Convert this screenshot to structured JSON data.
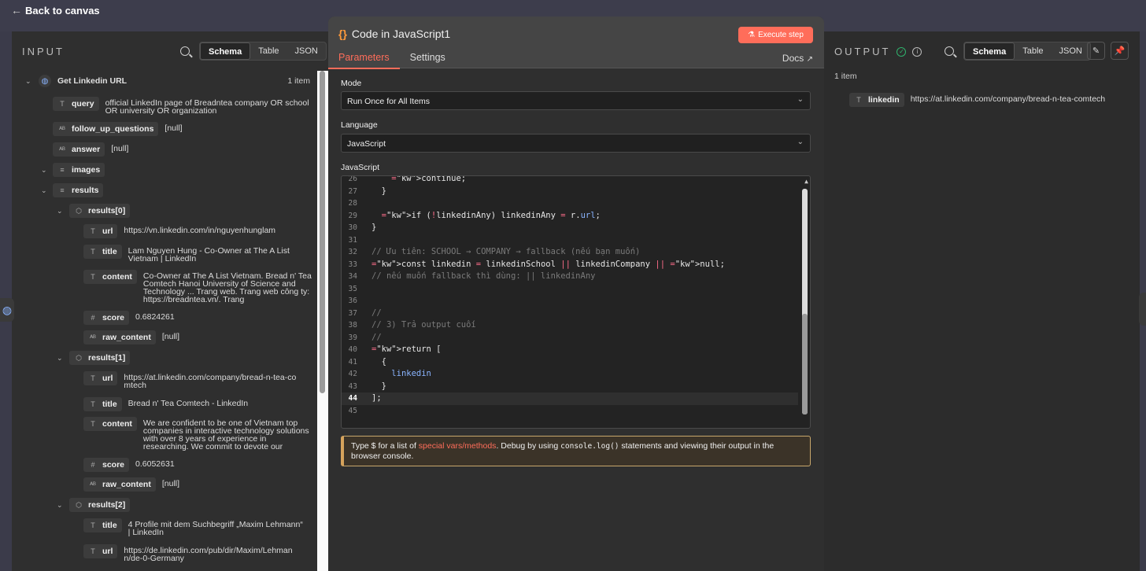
{
  "topbar": {
    "back_label": "Back to canvas"
  },
  "input": {
    "title": "INPUT",
    "view_tabs": [
      "Schema",
      "Table",
      "JSON"
    ],
    "root": {
      "label": "Get Linkedin URL",
      "count": "1 item"
    },
    "fields": {
      "query": {
        "key": "query",
        "value": "official LinkedIn page of Breadntea company OR school OR university OR organization"
      },
      "follow_up_questions": {
        "key": "follow_up_questions",
        "value": "[null]"
      },
      "answer": {
        "key": "answer",
        "value": "[null]"
      },
      "images": {
        "key": "images"
      },
      "results": {
        "key": "results"
      }
    },
    "results": [
      {
        "key": "results[0]",
        "url": "https://vn.linkedin.com/in/nguyenhunglam",
        "title": "Lam Nguyen Hung - Co-Owner at The A List Vietnam | LinkedIn",
        "content": "Co-Owner at The A List Vietnam. Bread n' Tea Comtech Hanoi University of Science and Technology ... Trang web. Trang web công ty: https://breadntea.vn/. Trang",
        "score": "0.6824261",
        "raw_content": "[null]"
      },
      {
        "key": "results[1]",
        "url": "https://at.linkedin.com/company/bread-n-tea-comtech",
        "title": "Bread n' Tea Comtech - LinkedIn",
        "content": "We are confident to be one of Vietnam top companies in interactive technology solutions with over 8 years of experience in researching. We commit to devote our",
        "score": "0.6052631",
        "raw_content": "[null]"
      },
      {
        "key": "results[2]",
        "title": "4 Profile mit dem Suchbegriff „Maxim Lehmann“ | LinkedIn",
        "url": "https://de.linkedin.com/pub/dir/Maxim/Lehmann/de-0-Germany"
      }
    ],
    "labels": {
      "url": "url",
      "title": "title",
      "content": "content",
      "score": "score",
      "raw_content": "raw_content"
    }
  },
  "modal": {
    "title": "Code in JavaScript1",
    "execute_label": "Execute step",
    "tabs": [
      "Parameters",
      "Settings"
    ],
    "docs_label": "Docs",
    "mode_label": "Mode",
    "mode_value": "Run Once for All Items",
    "language_label": "Language",
    "language_value": "JavaScript",
    "code_label": "JavaScript",
    "code_lines": [
      {
        "n": "26",
        "t": "    continue;"
      },
      {
        "n": "27",
        "t": "  }"
      },
      {
        "n": "28",
        "t": ""
      },
      {
        "n": "29",
        "t": "  if (!linkedinAny) linkedinAny = r.url;"
      },
      {
        "n": "30",
        "t": "}"
      },
      {
        "n": "31",
        "t": ""
      },
      {
        "n": "32",
        "t": "// Ưu tiên: SCHOOL → COMPANY → fallback (nếu bạn muốn)"
      },
      {
        "n": "33",
        "t": "const linkedin = linkedinSchool || linkedinCompany || null;"
      },
      {
        "n": "34",
        "t": "// nếu muốn fallback thì dùng: || linkedinAny"
      },
      {
        "n": "35",
        "t": ""
      },
      {
        "n": "36",
        "t": ""
      },
      {
        "n": "37",
        "t": "//"
      },
      {
        "n": "38",
        "t": "// 3) Trả output cuối"
      },
      {
        "n": "39",
        "t": "//"
      },
      {
        "n": "40",
        "t": "return ["
      },
      {
        "n": "41",
        "t": "  {"
      },
      {
        "n": "42",
        "t": "    linkedin"
      },
      {
        "n": "43",
        "t": "  }"
      },
      {
        "n": "44",
        "t": "];"
      },
      {
        "n": "45",
        "t": ""
      }
    ],
    "hint": {
      "prefix": "Type $ for a list of ",
      "link": "special vars/methods",
      "middle": ". Debug by using ",
      "code": "console.log()",
      "suffix": " statements and viewing their output in the browser console."
    }
  },
  "output": {
    "title": "OUTPUT",
    "view_tabs": [
      "Schema",
      "Table",
      "JSON"
    ],
    "count": "1 item",
    "field": {
      "key": "linkedin",
      "value": "https://at.linkedin.com/company/bread-n-tea-comtech"
    }
  },
  "colors": {
    "accent": "#ff6d5a",
    "success": "#2fb36d",
    "link": "#8ab4ff"
  }
}
